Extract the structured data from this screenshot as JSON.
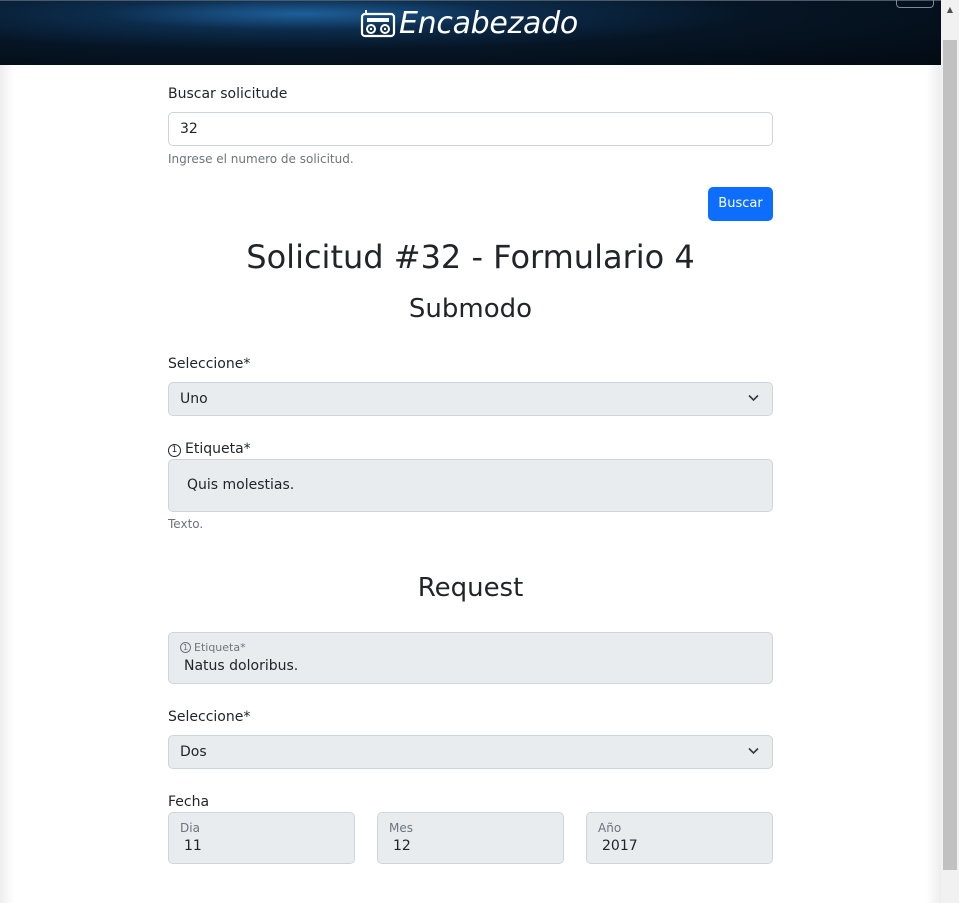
{
  "header": {
    "brand_icon": "radio-icon",
    "brand_text": "Encabezado"
  },
  "search": {
    "label": "Buscar solicitude",
    "value": "32",
    "help": "Ingrese el numero de solicitud.",
    "button_label": "Buscar"
  },
  "page_title": "Solicitud #32 - Formulario 4",
  "submodo": {
    "title": "Submodo",
    "select_label": "Seleccione*",
    "select_value": "Uno",
    "etiqueta_label": "Etiqueta*",
    "etiqueta_value": "Quis molestias.",
    "etiqueta_help": "Texto."
  },
  "request": {
    "title": "Request",
    "etiqueta_label": "Etiqueta*",
    "etiqueta_value": "Natus doloribus.",
    "select_label": "Seleccione*",
    "select_value": "Dos",
    "fecha_label": "Fecha",
    "dia_label": "Dia",
    "dia_value": "11",
    "mes_label": "Mes",
    "mes_value": "12",
    "anio_label": "Año",
    "anio_value": "2017"
  },
  "colors": {
    "primary": "#0d6efd",
    "disabled_bg": "#e9ecef",
    "border": "#ced4da",
    "muted": "#6c757d"
  }
}
